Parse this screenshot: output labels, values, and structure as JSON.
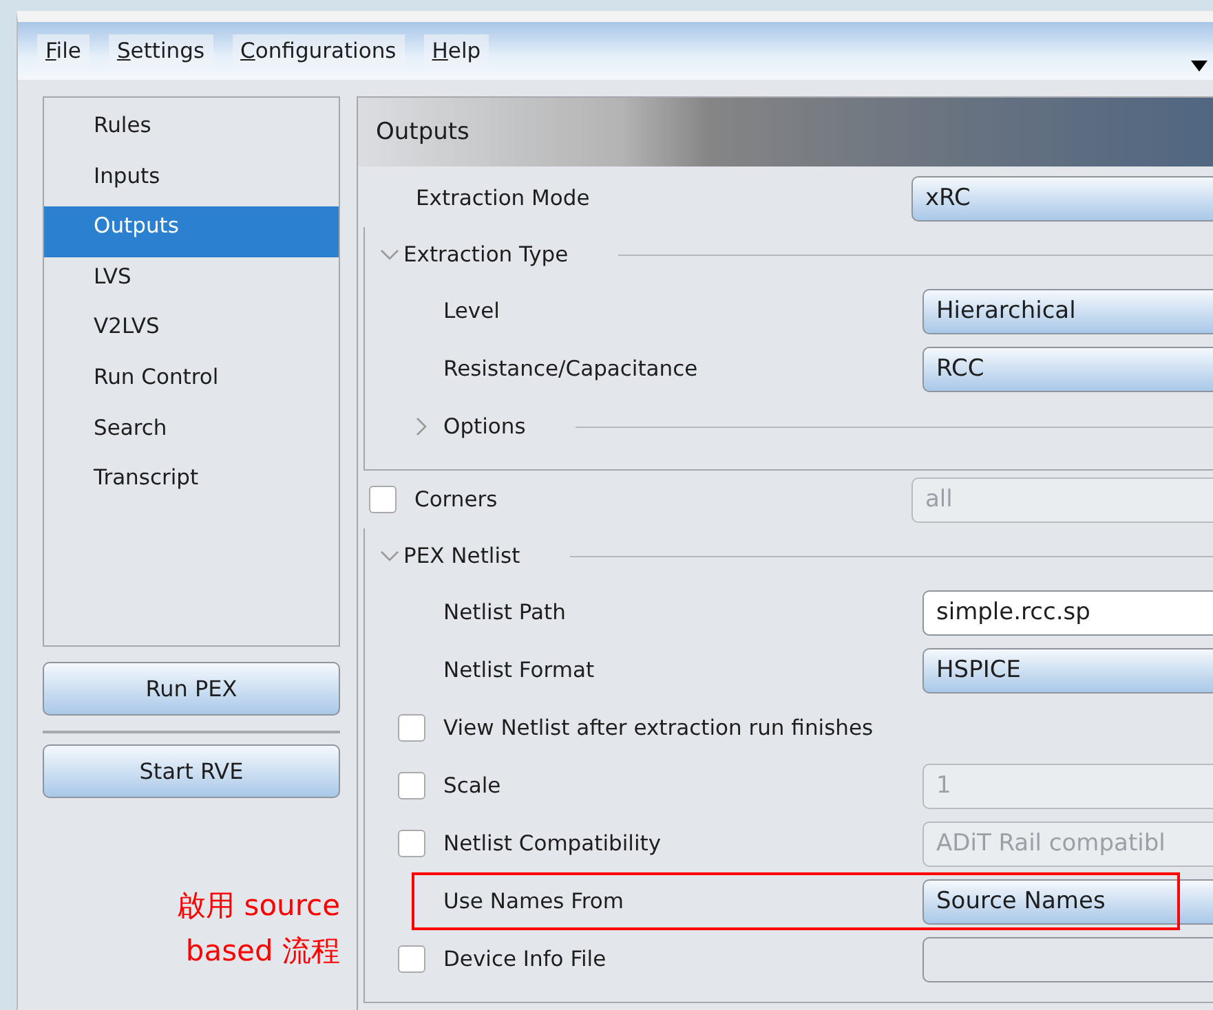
{
  "menu": [
    {
      "label": "File"
    },
    {
      "label": "Settings"
    },
    {
      "label": "Configurations"
    },
    {
      "label": "Help"
    }
  ],
  "sidebar": {
    "items": [
      {
        "label": "Rules",
        "selected": false
      },
      {
        "label": "Inputs",
        "selected": false
      },
      {
        "label": "Outputs",
        "selected": true
      },
      {
        "label": "LVS",
        "selected": false
      },
      {
        "label": "V2LVS",
        "selected": false
      },
      {
        "label": "Run Control",
        "selected": false
      },
      {
        "label": "Search",
        "selected": false
      },
      {
        "label": "Transcript",
        "selected": false
      }
    ]
  },
  "buttons": [
    "Run PEX",
    "Start RVE"
  ],
  "annotation": "啟用 source based 流程",
  "panel": {
    "title": "Outputs",
    "rows": [
      {
        "kind": "select",
        "label": "Extraction Mode",
        "value": "xRC"
      },
      {
        "kind": "group",
        "label": "Extraction Type",
        "expanded": true,
        "children": [
          {
            "kind": "select",
            "label": "Level",
            "value": "Hierarchical"
          },
          {
            "kind": "select",
            "label": "Resistance/Capacitance",
            "value": "RCC"
          },
          {
            "kind": "subgroup",
            "label": "Options",
            "expanded": false
          }
        ]
      },
      {
        "kind": "check",
        "label": "Corners",
        "checked": false,
        "value": "all",
        "disabled": true
      },
      {
        "kind": "group",
        "label": "PEX Netlist",
        "expanded": true,
        "children": [
          {
            "kind": "text",
            "label": "Netlist Path",
            "value": "simple.rcc.sp"
          },
          {
            "kind": "select",
            "label": "Netlist Format",
            "value": "HSPICE"
          },
          {
            "kind": "check",
            "label": "View Netlist after extraction run finishes",
            "checked": false
          },
          {
            "kind": "check",
            "label": "Scale",
            "checked": false,
            "value": "1",
            "disabled": true
          },
          {
            "kind": "check",
            "label": "Netlist Compatibility",
            "checked": false,
            "value": "ADiT Rail compatibl",
            "disabled": true
          },
          {
            "kind": "select",
            "label": "Use Names From",
            "value": "Source Names",
            "highlighted": true
          },
          {
            "kind": "check",
            "label": "Device Info File",
            "checked": false,
            "disabled": false
          }
        ]
      }
    ]
  }
}
